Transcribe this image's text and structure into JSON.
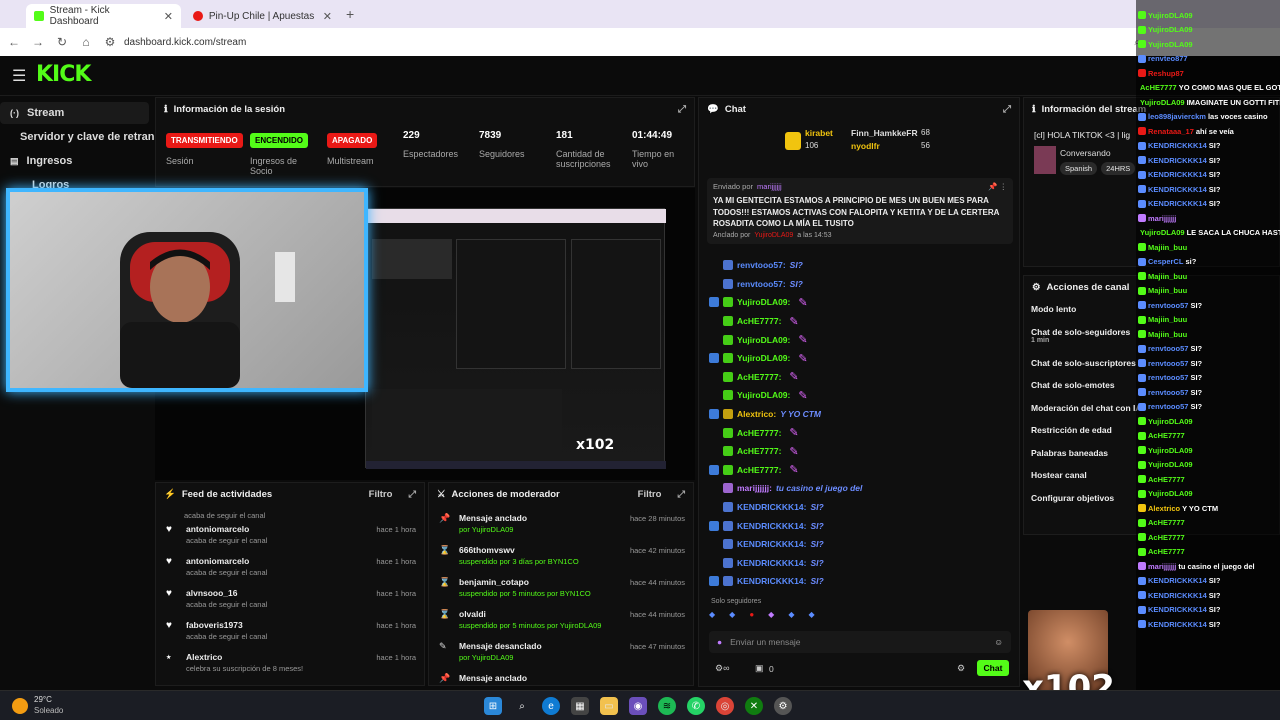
{
  "browser": {
    "tabs": [
      {
        "label": "Stream - Kick Dashboard"
      },
      {
        "label": "Pin-Up Chile | Apuestas y Casino"
      }
    ],
    "url": "dashboard.kick.com/stream"
  },
  "sidebar": {
    "items": [
      {
        "label": "Stream"
      },
      {
        "label": "Servidor y clave de retransmisión"
      },
      {
        "label": "Ingresos"
      },
      {
        "label": "Logros"
      }
    ]
  },
  "session": {
    "title": "Información de la sesión",
    "badges": [
      {
        "label": "TRANSMITIENDO",
        "caption": "Sesión",
        "bg": "#e91916",
        "fg": "#fff"
      },
      {
        "label": "ENCENDIDO",
        "caption": "Ingresos de Socio",
        "bg": "#53fc18",
        "fg": "#000"
      },
      {
        "label": "APAGADO",
        "caption": "Multistream",
        "bg": "#e91916",
        "fg": "#fff"
      }
    ],
    "stats": [
      {
        "value": "229",
        "caption": "Espectadores"
      },
      {
        "value": "7839",
        "caption": "Seguidores"
      },
      {
        "value": "181",
        "caption": "Cantidad de suscripciones"
      },
      {
        "value": "01:44:49",
        "caption": "Tiempo en vivo"
      }
    ]
  },
  "feed": {
    "title": "Feed de actividades",
    "filter": "Filtro",
    "first_sub": "acaba de seguir el canal",
    "rows": [
      {
        "name": "antoniomarcelo",
        "sub": "acaba de seguir el canal",
        "time": "hace 1 hora"
      },
      {
        "name": "antoniomarcelo",
        "sub": "acaba de seguir el canal",
        "time": "hace 1 hora"
      },
      {
        "name": "alvnsooo_16",
        "sub": "acaba de seguir el canal",
        "time": "hace 1 hora"
      },
      {
        "name": "faboveris1973",
        "sub": "acaba de seguir el canal",
        "time": "hace 1 hora"
      },
      {
        "name": "Alextrico",
        "sub": "celebra su suscripción de 8 meses!",
        "time": "hace 1 hora"
      }
    ]
  },
  "modactions": {
    "title": "Acciones de moderador",
    "filter": "Filtro",
    "rows": [
      {
        "name": "Mensaje anclado",
        "sub": "por YujiroDLA09",
        "time": "hace 28 minutos"
      },
      {
        "name": "666thomvswv",
        "sub": "suspendido por 3 días por BYN1CO",
        "time": "hace 42 minutos"
      },
      {
        "name": "benjamin_cotapo",
        "sub": "suspendido por 5 minutos por BYN1CO",
        "time": "hace 44 minutos"
      },
      {
        "name": "olvaldi",
        "sub": "suspendido por 5 minutos por YujiroDLA09",
        "time": "hace 44 minutos"
      },
      {
        "name": "Mensaje desanclado",
        "sub": "por YujiroDLA09",
        "time": "hace 47 minutos"
      },
      {
        "name": "Mensaje anclado",
        "sub": "",
        "time": ""
      }
    ]
  },
  "chat": {
    "title": "Chat",
    "top": [
      {
        "name": "kirabet",
        "value": "106"
      },
      {
        "name": "Finn_HamkkeFR",
        "value": "68"
      },
      {
        "name": "nyodlfr",
        "value": "56"
      }
    ],
    "pinned": {
      "by_label": "Enviado por",
      "by_user": "marijjjjjj",
      "text": "YA MI GENTECITA ESTAMOS A PRINCIPIO DE MES UN BUEN MES PARA TODOS!!! ESTAMOS ACTIVAS CON FALOPITA Y KETITA Y DE LA CERTERA ROSADITA COMO LA MÍA EL TUSITO",
      "anchored": "Anclado por",
      "anchored_by": "YujiroDLA09",
      "anchored_time": "a las 14:53"
    },
    "messages": [
      {
        "user": "renvtooo57:",
        "text": "SI?",
        "color": "#5b8cff"
      },
      {
        "user": "renvtooo57:",
        "text": "SI?",
        "color": "#5b8cff"
      },
      {
        "user": "YujiroDLA09:",
        "text": "",
        "color": "#53fc18"
      },
      {
        "user": "AcHE7777:",
        "text": "",
        "color": "#53fc18"
      },
      {
        "user": "YujiroDLA09:",
        "text": "",
        "color": "#53fc18"
      },
      {
        "user": "YujiroDLA09:",
        "text": "",
        "color": "#53fc18"
      },
      {
        "user": "AcHE7777:",
        "text": "",
        "color": "#53fc18"
      },
      {
        "user": "YujiroDLA09:",
        "text": "",
        "color": "#53fc18"
      },
      {
        "user": "Alextrico:",
        "text": "Y YO CTM",
        "color": "#f1c40f"
      },
      {
        "user": "AcHE7777:",
        "text": "",
        "color": "#53fc18"
      },
      {
        "user": "AcHE7777:",
        "text": "",
        "color": "#53fc18"
      },
      {
        "user": "AcHE7777:",
        "text": "",
        "color": "#53fc18"
      },
      {
        "user": "marijjjjjj:",
        "text": "tu casino el juego del",
        "color": "#c07bff"
      },
      {
        "user": "KENDRICKKK14:",
        "text": "SI?",
        "color": "#5b8cff"
      },
      {
        "user": "KENDRICKKK14:",
        "text": "SI?",
        "color": "#5b8cff"
      },
      {
        "user": "KENDRICKKK14:",
        "text": "SI?",
        "color": "#5b8cff"
      },
      {
        "user": "KENDRICKKK14:",
        "text": "SI?",
        "color": "#5b8cff"
      },
      {
        "user": "KENDRICKKK14:",
        "text": "SI?",
        "color": "#5b8cff"
      }
    ],
    "followers_only": "Solo seguidores",
    "placeholder": "Enviar un mensaje",
    "count": "0",
    "send": "Chat"
  },
  "streaminfo": {
    "title": "Información del stream",
    "stream_title": "[cl] HOLA TIKTOK <3 | lig",
    "sub": "Conversando",
    "tags": [
      "Spanish",
      "24HRS"
    ]
  },
  "channel": {
    "title": "Acciones de canal",
    "items": [
      {
        "label": "Modo lento"
      },
      {
        "label": "Chat de solo-seguidores",
        "sub": "1 min"
      },
      {
        "label": "Chat de solo-suscriptores"
      },
      {
        "label": "Chat de solo-emotes"
      },
      {
        "label": "Moderación del chat con IA"
      },
      {
        "label": "Restricción de edad"
      },
      {
        "label": "Palabras baneadas"
      },
      {
        "label": "Hostear canal"
      },
      {
        "label": "Configurar objetivos"
      }
    ]
  },
  "overlay": {
    "lines": [
      {
        "u": "YujiroDLA09",
        "t": "",
        "c": "#53fc18"
      },
      {
        "u": "YujiroDLA09",
        "t": "",
        "c": "#53fc18"
      },
      {
        "u": "YujiroDLA09",
        "t": "",
        "c": "#53fc18"
      },
      {
        "u": "renvteo877",
        "t": "",
        "c": "#5b8cff"
      },
      {
        "u": "Reshup87",
        "t": "",
        "c": "#e91916"
      },
      {
        "u": "AcHE7777",
        "t": "YO COMO MAS QUE EL GOTTI",
        "c": "#53fc18"
      },
      {
        "u": "YujiroDLA09",
        "t": "IMAGINATE UN GOTTI FITNESS WN",
        "c": "#53fc18"
      },
      {
        "u": "leo898javierckm",
        "t": "las voces casino",
        "c": "#5b8cff"
      },
      {
        "u": "Renataaa_17",
        "t": "ahí se veía",
        "c": "#e91916"
      },
      {
        "u": "KENDRICKKK14",
        "t": "SI?",
        "c": "#5b8cff"
      },
      {
        "u": "KENDRICKKK14",
        "t": "SI?",
        "c": "#5b8cff"
      },
      {
        "u": "KENDRICKKK14",
        "t": "SI?",
        "c": "#5b8cff"
      },
      {
        "u": "KENDRICKKK14",
        "t": "SI?",
        "c": "#5b8cff"
      },
      {
        "u": "KENDRICKKK14",
        "t": "SI?",
        "c": "#5b8cff"
      },
      {
        "u": "marijjjjjj",
        "t": "",
        "c": "#c07bff"
      },
      {
        "u": "YujiroDLA09",
        "t": "LE SACA LA CHUCA HASTA EL CUADRAO BIG",
        "c": "#53fc18"
      },
      {
        "u": "Majiin_buu",
        "t": "",
        "c": "#53fc18"
      },
      {
        "u": "CesperCL",
        "t": "si?",
        "c": "#5b8cff"
      },
      {
        "u": "Majiin_buu",
        "t": "",
        "c": "#53fc18"
      },
      {
        "u": "Majiin_buu",
        "t": "",
        "c": "#53fc18"
      },
      {
        "u": "renvtooo57",
        "t": "SI?",
        "c": "#5b8cff"
      },
      {
        "u": "Majiin_buu",
        "t": "",
        "c": "#53fc18"
      },
      {
        "u": "Majiin_buu",
        "t": "",
        "c": "#53fc18"
      },
      {
        "u": "renvtooo57",
        "t": "SI?",
        "c": "#5b8cff"
      },
      {
        "u": "renvtooo57",
        "t": "SI?",
        "c": "#5b8cff"
      },
      {
        "u": "renvtooo57",
        "t": "SI?",
        "c": "#5b8cff"
      },
      {
        "u": "renvtooo57",
        "t": "SI?",
        "c": "#5b8cff"
      },
      {
        "u": "renvtooo57",
        "t": "SI?",
        "c": "#5b8cff"
      },
      {
        "u": "YujiroDLA09",
        "t": "",
        "c": "#53fc18"
      },
      {
        "u": "AcHE7777",
        "t": "",
        "c": "#53fc18"
      },
      {
        "u": "YujiroDLA09",
        "t": "",
        "c": "#53fc18"
      },
      {
        "u": "YujiroDLA09",
        "t": "",
        "c": "#53fc18"
      },
      {
        "u": "AcHE7777",
        "t": "",
        "c": "#53fc18"
      },
      {
        "u": "YujiroDLA09",
        "t": "",
        "c": "#53fc18"
      },
      {
        "u": "Alextrico",
        "t": "Y YO CTM",
        "c": "#f1c40f"
      },
      {
        "u": "AcHE7777",
        "t": "",
        "c": "#53fc18"
      },
      {
        "u": "AcHE7777",
        "t": "",
        "c": "#53fc18"
      },
      {
        "u": "AcHE7777",
        "t": "",
        "c": "#53fc18"
      },
      {
        "u": "marijjjjjj",
        "t": "tu casino el juego del",
        "c": "#c07bff"
      },
      {
        "u": "KENDRICKKK14",
        "t": "SI?",
        "c": "#5b8cff"
      },
      {
        "u": "KENDRICKKK14",
        "t": "SI?",
        "c": "#5b8cff"
      },
      {
        "u": "KENDRICKKK14",
        "t": "SI?",
        "c": "#5b8cff"
      },
      {
        "u": "KENDRICKKK14",
        "t": "SI?",
        "c": "#5b8cff"
      }
    ],
    "x102": "x102"
  },
  "taskbar": {
    "temp": "29°C",
    "weather": "Soleado"
  },
  "colors": {
    "kick_green": "#53fc18",
    "live_red": "#e91916",
    "cam_border": "#3fb6ff"
  }
}
